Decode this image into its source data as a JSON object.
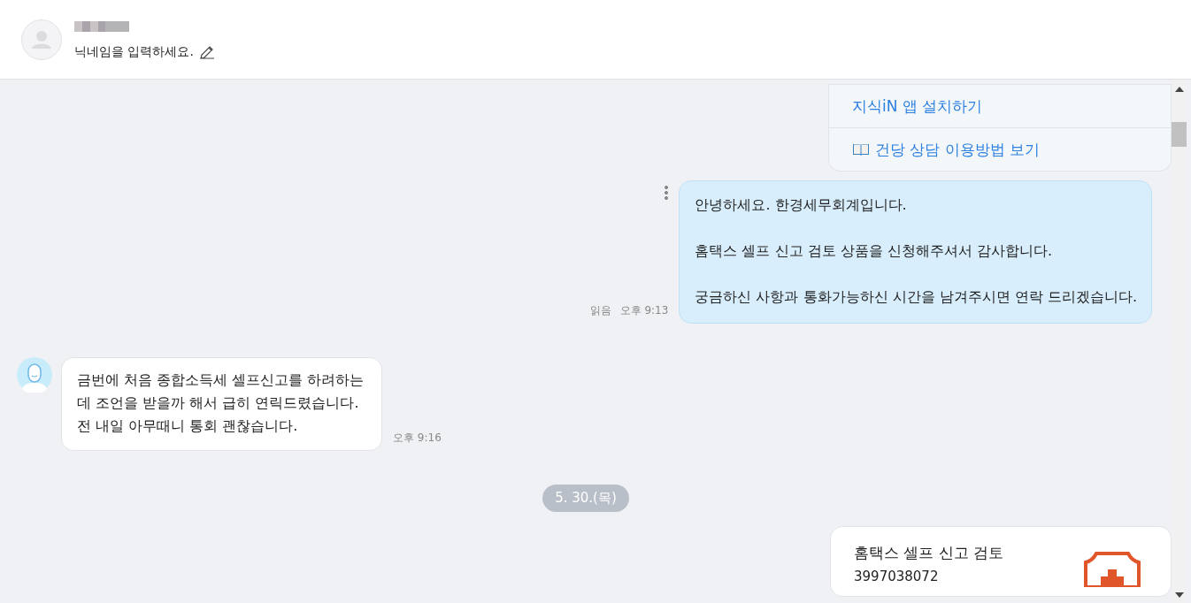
{
  "header": {
    "nickname_placeholder": "닉네임을 입력하세요."
  },
  "guide_links": [
    {
      "kind": "plain",
      "label": "지식iN 앱 설치하기"
    },
    {
      "kind": "book",
      "label": "건당 상담 이용방법 보기"
    }
  ],
  "messages": [
    {
      "kind": "outgoing",
      "paragraphs": [
        "안녕하세요. 한경세무회계입니다.",
        "홈택스 셀프 신고 검토 상품을 신청해주셔서 감사합니다.",
        "궁금하신 사항과 통화가능하신 시간을 남겨주시면 연락 드리겠습니다."
      ],
      "read": "읽음",
      "time": "오후 9:13"
    },
    {
      "kind": "incoming",
      "paragraphs": [
        "금번에 처음 종합소득세 셀프신고를 하려하는데 조언을 받을까 해서 급히 연릭드렸습니다. 전 내일 아무때니 통회 괜찮습니다."
      ],
      "time": "오후 9:16"
    },
    {
      "kind": "date",
      "label": "5. 30.(목)"
    },
    {
      "kind": "product",
      "title": "홈택스 셀프 신고 검토",
      "code": "3997038072"
    }
  ]
}
